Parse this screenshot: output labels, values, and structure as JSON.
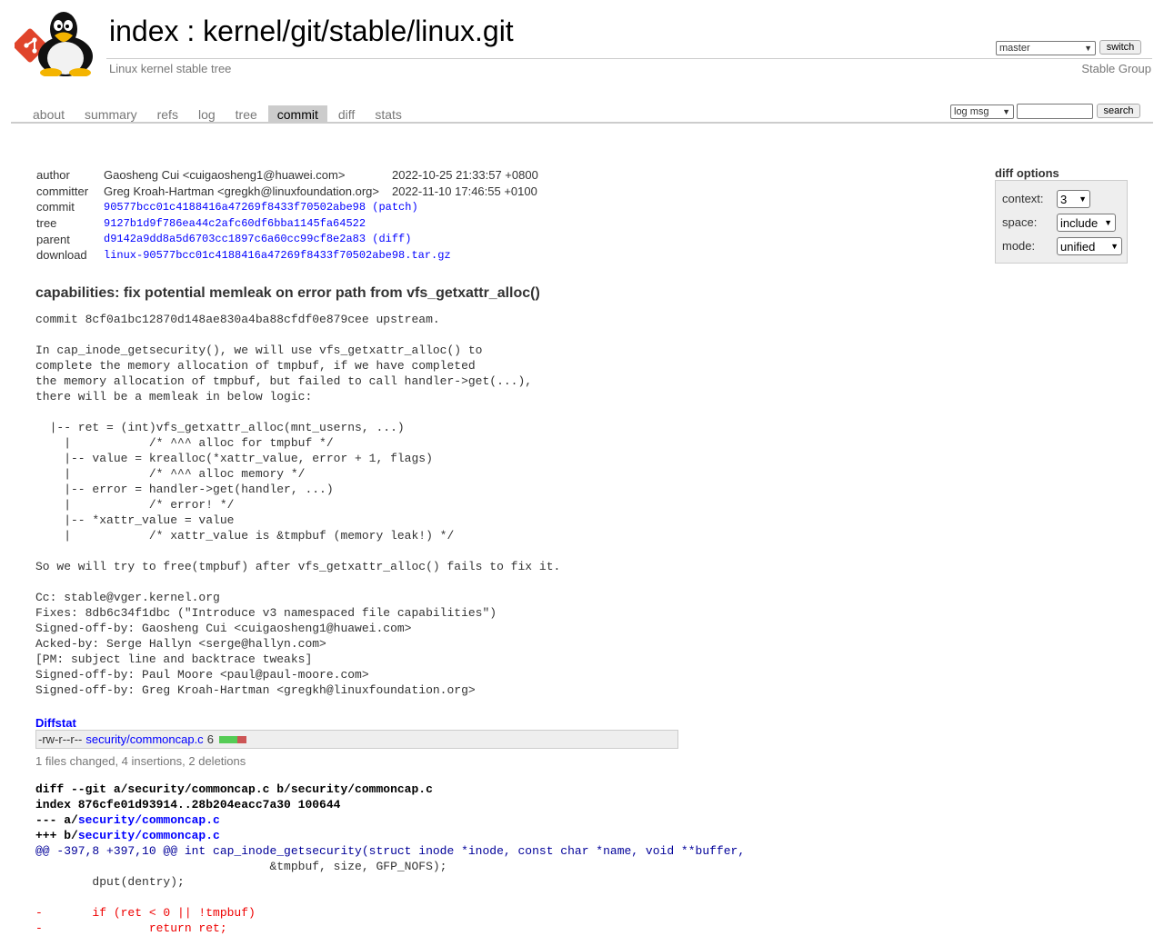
{
  "header": {
    "repo_prefix": "index",
    "separator": " : ",
    "repo_path": "kernel/git/stable/linux.git",
    "description": "Linux kernel stable tree",
    "owner": "Stable Group",
    "branch_selected": "master",
    "switch_label": "switch"
  },
  "tabs": [
    "about",
    "summary",
    "refs",
    "log",
    "tree",
    "commit",
    "diff",
    "stats"
  ],
  "active_tab": "commit",
  "search": {
    "mode_selected": "log msg",
    "value": "",
    "button_label": "search"
  },
  "commit_info": {
    "author_label": "author",
    "author": "Gaosheng Cui <cuigaosheng1@huawei.com>",
    "author_date": "2022-10-25 21:33:57 +0800",
    "committer_label": "committer",
    "committer": "Greg Kroah-Hartman <gregkh@linuxfoundation.org>",
    "committer_date": "2022-11-10 17:46:55 +0100",
    "commit_label": "commit",
    "commit_hash": "90577bcc01c4188416a47269f8433f70502abe98",
    "patch_link": "(patch)",
    "tree_label": "tree",
    "tree_hash": "9127b1d9f786ea44c2afc60df6bba1145fa64522",
    "parent_label": "parent",
    "parent_hash": "d9142a9dd8a5d6703cc1897c6a60cc99cf8e2a83",
    "diff_link": "(diff)",
    "download_label": "download",
    "download_file": "linux-90577bcc01c4188416a47269f8433f70502abe98.tar.gz"
  },
  "diff_options": {
    "title": "diff options",
    "context_label": "context:",
    "context_value": "3",
    "space_label": "space:",
    "space_value": "include",
    "mode_label": "mode:",
    "mode_value": "unified"
  },
  "commit_subject": "capabilities: fix potential memleak on error path from vfs_getxattr_alloc()",
  "commit_message": "commit 8cf0a1bc12870d148ae830a4ba88cfdf0e879cee upstream.\n\nIn cap_inode_getsecurity(), we will use vfs_getxattr_alloc() to\ncomplete the memory allocation of tmpbuf, if we have completed\nthe memory allocation of tmpbuf, but failed to call handler->get(...),\nthere will be a memleak in below logic:\n\n  |-- ret = (int)vfs_getxattr_alloc(mnt_userns, ...)\n    |           /* ^^^ alloc for tmpbuf */\n    |-- value = krealloc(*xattr_value, error + 1, flags)\n    |           /* ^^^ alloc memory */\n    |-- error = handler->get(handler, ...)\n    |           /* error! */\n    |-- *xattr_value = value\n    |           /* xattr_value is &tmpbuf (memory leak!) */\n\nSo we will try to free(tmpbuf) after vfs_getxattr_alloc() fails to fix it.\n\nCc: stable@vger.kernel.org\nFixes: 8db6c34f1dbc (\"Introduce v3 namespaced file capabilities\")\nSigned-off-by: Gaosheng Cui <cuigaosheng1@huawei.com>\nAcked-by: Serge Hallyn <serge@hallyn.com>\n[PM: subject line and backtrace tweaks]\nSigned-off-by: Paul Moore <paul@paul-moore.com>\nSigned-off-by: Greg Kroah-Hartman <gregkh@linuxfoundation.org>",
  "diffstat": {
    "title": "Diffstat",
    "mode": "-rw-r--r--",
    "file": "security/commoncap.c",
    "changes": "6",
    "insertions_fraction": 0.667,
    "summary": "1 files changed, 4 insertions, 2 deletions",
    "colors": {
      "add": "#55cc55",
      "del": "#cc5555"
    }
  },
  "diff": {
    "git_line": "diff --git a/security/commoncap.c b/security/commoncap.c",
    "index_line": "index 876cfe01d93914..28b204eacc7a30 100644",
    "minus_prefix": "--- a/",
    "plus_prefix": "+++ b/",
    "file_path": "security/commoncap.c",
    "hunk_header": "@@ -397,8 +397,10 @@ int cap_inode_getsecurity(struct inode *inode, const char *name, void **buffer,",
    "lines": [
      {
        "type": "ctx",
        "text": "                                 &tmpbuf, size, GFP_NOFS);"
      },
      {
        "type": "ctx",
        "text": "        dput(dentry);"
      },
      {
        "type": "ctx",
        "text": " "
      },
      {
        "type": "del",
        "text": "-       if (ret < 0 || !tmpbuf)"
      },
      {
        "type": "del",
        "text": "-               return ret;"
      }
    ]
  }
}
